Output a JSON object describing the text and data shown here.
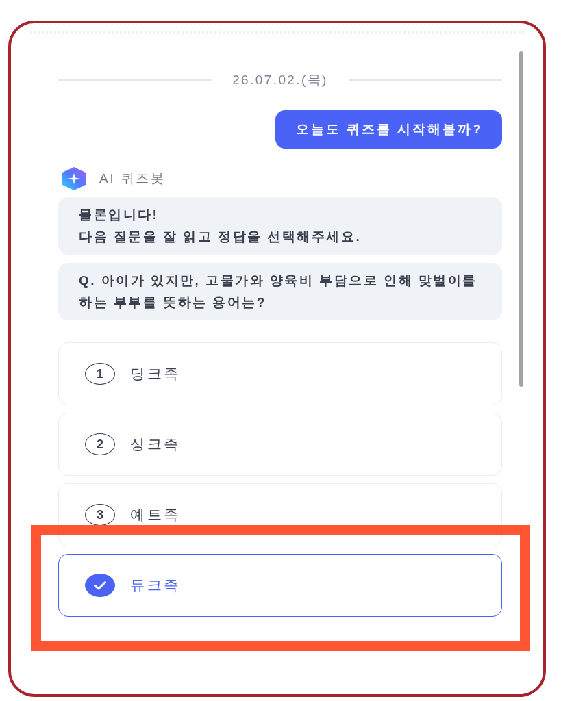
{
  "chat": {
    "date": "26.07.02.(목)",
    "messages": [
      {
        "kind": "user",
        "text": "오늘도 퀴즈를 시작해볼까?"
      },
      {
        "kind": "bot",
        "sender": "AI 퀴즈봇",
        "bubbles": [
          "물론입니다!\n다음 질문을 잘 읽고 정답을 선택해주세요.",
          "Q. 아이가 있지만, 고물가와 양육비 부담으로 인해 맞벌이를 하는 부부를 뜻하는 용어는?"
        ]
      }
    ]
  },
  "answer_options": [
    {
      "number": "1",
      "label": "딩크족",
      "selected": false,
      "highlighted": false
    },
    {
      "number": "2",
      "label": "싱크족",
      "selected": false,
      "highlighted": false
    },
    {
      "number": "3",
      "label": "예트족",
      "selected": false,
      "highlighted": false
    },
    {
      "label": "듀크족",
      "selected": true,
      "highlighted": true
    }
  ]
}
